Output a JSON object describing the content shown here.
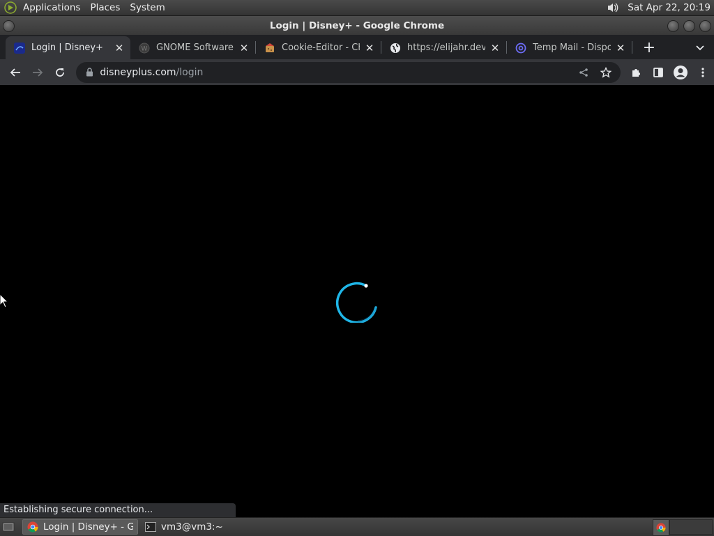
{
  "top_panel": {
    "menus": [
      "Applications",
      "Places",
      "System"
    ],
    "clock": "Sat Apr 22, 20:19"
  },
  "window": {
    "title": "Login | Disney+ - Google Chrome"
  },
  "tabs": [
    {
      "title": "Login | Disney+",
      "active": true,
      "icon": "disney-icon"
    },
    {
      "title": "GNOME Software -",
      "active": false,
      "icon": "wordpress-icon"
    },
    {
      "title": "Cookie-Editor - Chro",
      "active": false,
      "icon": "cookie-icon"
    },
    {
      "title": "https://elijahr.dev/p",
      "active": false,
      "icon": "globe-icon"
    },
    {
      "title": "Temp Mail - Dispos",
      "active": false,
      "icon": "at-icon"
    }
  ],
  "address_bar": {
    "host": "disneyplus.com",
    "path": "/login"
  },
  "status": {
    "text": "Establishing secure connection..."
  },
  "taskbar": {
    "tasks": [
      {
        "label": "Login | Disney+ - Go...",
        "active": true,
        "icon": "chrome-icon"
      },
      {
        "label": "vm3@vm3:~",
        "active": false,
        "icon": "terminal-icon"
      }
    ]
  },
  "colors": {
    "spinner": "#1fb6e8",
    "background": "#000000"
  }
}
